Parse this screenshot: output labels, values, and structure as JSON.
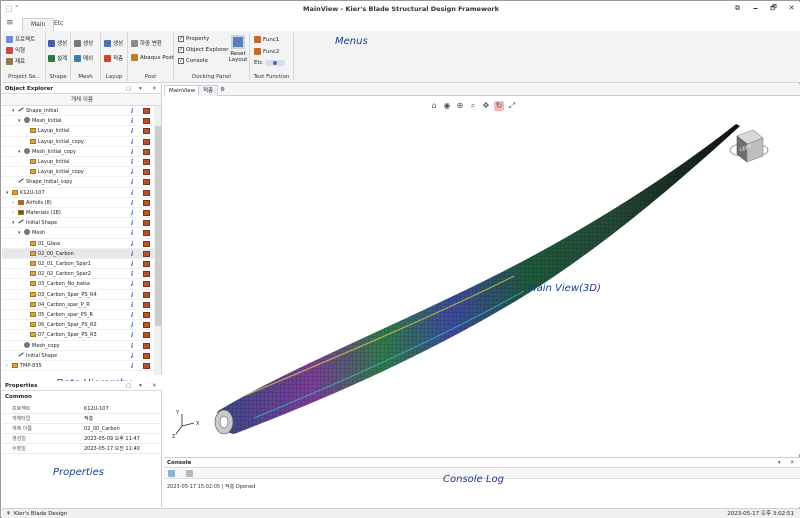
{
  "window": {
    "title": "MainView - Kier's Blade Structural Design Framework",
    "app_menu_icon": "app-menu-icon",
    "controls": [
      "⧉",
      "🗕",
      "🗗",
      "✕"
    ]
  },
  "ribbon": {
    "file_icon": "≡",
    "tabs": [
      {
        "label": "Main"
      },
      {
        "label": "Etc"
      }
    ],
    "groups": {
      "project": {
        "name": "Project Se...",
        "items": [
          "프로젝트",
          "익형",
          "재료"
        ]
      },
      "shape": {
        "name": "Shape",
        "items": [
          "생성",
          "설계"
        ]
      },
      "mesh": {
        "name": "Mesh",
        "items": [
          "생성",
          "메쉬"
        ]
      },
      "layup": {
        "name": "Layup",
        "items": [
          "생성",
          "적층"
        ]
      },
      "post": {
        "name": "Post",
        "items": [
          "하중 변환",
          "Abaqus Post"
        ]
      },
      "docking": {
        "name": "Docking Panel",
        "items": [
          "Property",
          "Object Explorer",
          "Console"
        ],
        "reset_label": "Reset Layout"
      },
      "testfn": {
        "name": "Test Function",
        "items": [
          "Func1",
          "Func2",
          "Etc"
        ]
      }
    }
  },
  "annotations": {
    "menus": "Menus",
    "data_hierarchy": "Data Hierarchy",
    "properties": "Properties",
    "main_view": "Main View(3D)",
    "console_log": "Console Log"
  },
  "explorer": {
    "title": "Object Explorer",
    "controls": [
      "▢",
      "▾",
      "✕"
    ],
    "column_header": "개체 이름",
    "rows": [
      {
        "label": "Shape_Initial",
        "depth": 1,
        "kind": "line",
        "exp": "▾"
      },
      {
        "label": "Mesh_Initial",
        "depth": 2,
        "kind": "gear",
        "exp": "▾"
      },
      {
        "label": "Layup_Initial",
        "depth": 3,
        "kind": "box",
        "exp": ""
      },
      {
        "label": "Layup_initial_copy",
        "depth": 3,
        "kind": "box",
        "exp": ""
      },
      {
        "label": "Mesh_Initial_copy",
        "depth": 2,
        "kind": "gear",
        "exp": "▾"
      },
      {
        "label": "Layup_Initial",
        "depth": 3,
        "kind": "box",
        "exp": ""
      },
      {
        "label": "Layup_initial_copy",
        "depth": 3,
        "kind": "box",
        "exp": ""
      },
      {
        "label": "Shape_Initial_copy",
        "depth": 1,
        "kind": "line",
        "exp": ""
      },
      {
        "label": "K12U-107",
        "depth": 0,
        "kind": "box",
        "exp": "▾"
      },
      {
        "label": "Airfoils (8)",
        "depth": 1,
        "kind": "air",
        "exp": "›"
      },
      {
        "label": "Materials (18)",
        "depth": 1,
        "kind": "mat",
        "exp": "›"
      },
      {
        "label": "Initial Shape",
        "depth": 1,
        "kind": "line",
        "exp": "▾"
      },
      {
        "label": "Mesh",
        "depth": 2,
        "kind": "gear",
        "exp": "▾"
      },
      {
        "label": "01_Glass",
        "depth": 3,
        "kind": "box",
        "exp": ""
      },
      {
        "label": "02_00_Carbon",
        "depth": 3,
        "kind": "box",
        "exp": "",
        "selected": true
      },
      {
        "label": "02_01_Carbon_Spar1",
        "depth": 3,
        "kind": "box",
        "exp": ""
      },
      {
        "label": "02_02_Carbon_Spar2",
        "depth": 3,
        "kind": "box",
        "exp": ""
      },
      {
        "label": "03_Carbon_No_balsa",
        "depth": 3,
        "kind": "box",
        "exp": ""
      },
      {
        "label": "03_Carbon_Spar_PS_R4",
        "depth": 3,
        "kind": "box",
        "exp": ""
      },
      {
        "label": "04_Carbon_spar_P_R",
        "depth": 3,
        "kind": "box",
        "exp": ""
      },
      {
        "label": "05_Carbon_spar_PS_R",
        "depth": 3,
        "kind": "box",
        "exp": ""
      },
      {
        "label": "06_Carbon_Spar_PS_R2",
        "depth": 3,
        "kind": "box",
        "exp": ""
      },
      {
        "label": "07_Carbon_Spar_PS_R3",
        "depth": 3,
        "kind": "box",
        "exp": ""
      },
      {
        "label": "Mesh_copy",
        "depth": 2,
        "kind": "gear",
        "exp": ""
      },
      {
        "label": "Initial Shape",
        "depth": 1,
        "kind": "line",
        "exp": ""
      },
      {
        "label": "TMP-835",
        "depth": 0,
        "kind": "box",
        "exp": "›"
      }
    ]
  },
  "properties": {
    "title": "Properties",
    "controls": [
      "▢",
      "▾",
      "✕"
    ],
    "category": "Common",
    "rows": [
      {
        "key": "프로젝트",
        "value": "K12U-107"
      },
      {
        "key": "개체타입",
        "value": "적층"
      },
      {
        "key": "개체 이름",
        "value": "02_00_Carbon"
      },
      {
        "key": "생성일",
        "value": "2023-05-09 오후 11:47"
      },
      {
        "key": "수정일",
        "value": "2023-05-17 오전 11:40"
      }
    ]
  },
  "doc_tabs": [
    {
      "label": "MainView"
    },
    {
      "label": "적층"
    }
  ],
  "doc_tab_settings_icon": "⚙",
  "viewer": {
    "tools": [
      "⌂",
      "◉",
      "⊕",
      "⌕",
      "✥",
      "↻",
      "⤢"
    ],
    "navcube_label": "LEFT",
    "axis_labels": {
      "y": "Y",
      "x": "X",
      "z": "Z"
    }
  },
  "console": {
    "title": "Console",
    "controls": [
      "▾",
      "✕"
    ],
    "log": "2023-05-17 15:02:05 | 적층 Opened"
  },
  "statusbar": {
    "left": "Kier's Blade Design",
    "right": "2023-05-17 오후 3:02:51"
  },
  "colors": {
    "accent": "#2b58c6",
    "ribbon_bg": "#f3f3f3",
    "annotation": "#1a3d8f"
  }
}
